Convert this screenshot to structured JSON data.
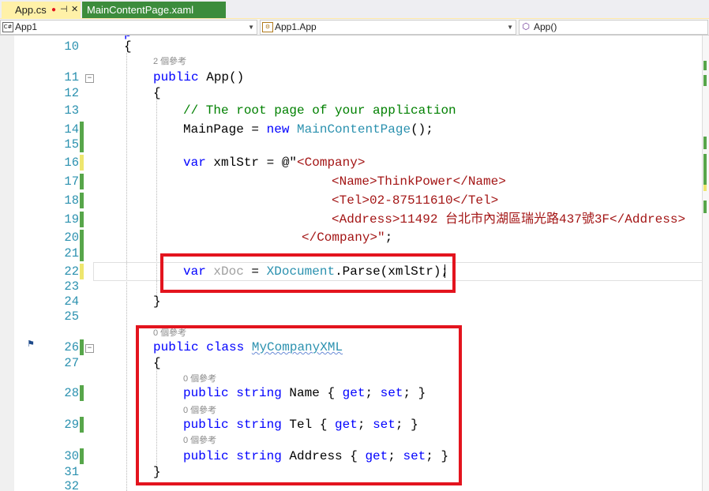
{
  "tabs": {
    "active": {
      "label": "App.cs",
      "pin": "⊣",
      "close": "✕"
    },
    "inactive": {
      "label": "MainContentPage.xaml"
    }
  },
  "nav": {
    "project": {
      "label": "App1",
      "icon": "C#"
    },
    "type": {
      "label": "App1.App",
      "icon": "class-icon"
    },
    "member": {
      "label": "App()",
      "icon": "method-icon"
    }
  },
  "lines": {
    "l10": "10",
    "l11": "11",
    "l12": "12",
    "l13": "13",
    "l14": "14",
    "l15": "15",
    "l16": "16",
    "l17": "17",
    "l18": "18",
    "l19": "19",
    "l20": "20",
    "l21": "21",
    "l22": "22",
    "l23": "23",
    "l24": "24",
    "l25": "25",
    "l26": "26",
    "l27": "27",
    "l28": "28",
    "l29": "29",
    "l30": "30",
    "l31": "31",
    "l32": "32"
  },
  "lens": {
    "ctor_refs": "2 個參考",
    "class_refs": "0 個參考",
    "name_refs": "0 個參考",
    "tel_refs": "0 個參考",
    "address_refs": "0 個參考"
  },
  "code": {
    "open_brace": "{",
    "close_brace": "}",
    "public": "public",
    "ctor_name": "App",
    "ctor_parens": "()",
    "comment": "// The root page of your application",
    "mainpage_assign": "MainPage = ",
    "new": "new",
    "mainpage_type": "MainContentPage",
    "mainpage_end": "();",
    "var": "var",
    "xmlstr_decl": " xmlStr = @\"",
    "xml_company_open": "<Company>",
    "xml_name": "<Name>ThinkPower</Name>",
    "xml_tel": "<Tel>02-87511610</Tel>",
    "xml_address": "<Address>11492 台北市內湖區瑞光路437號3F</Address>",
    "xml_company_close": "</Company>\"",
    "semicolon": ";",
    "xdoc_var": "xDoc",
    "eq": " = ",
    "xdocument": "XDocument",
    "parse_call": ".Parse(xmlStr);",
    "class": "class",
    "class_name": "MyCompanyXML",
    "string": "string",
    "prop_name": " Name { ",
    "prop_tel": " Tel { ",
    "prop_address": " Address { ",
    "get": "get",
    "set": "set",
    "prop_end": "; }"
  }
}
